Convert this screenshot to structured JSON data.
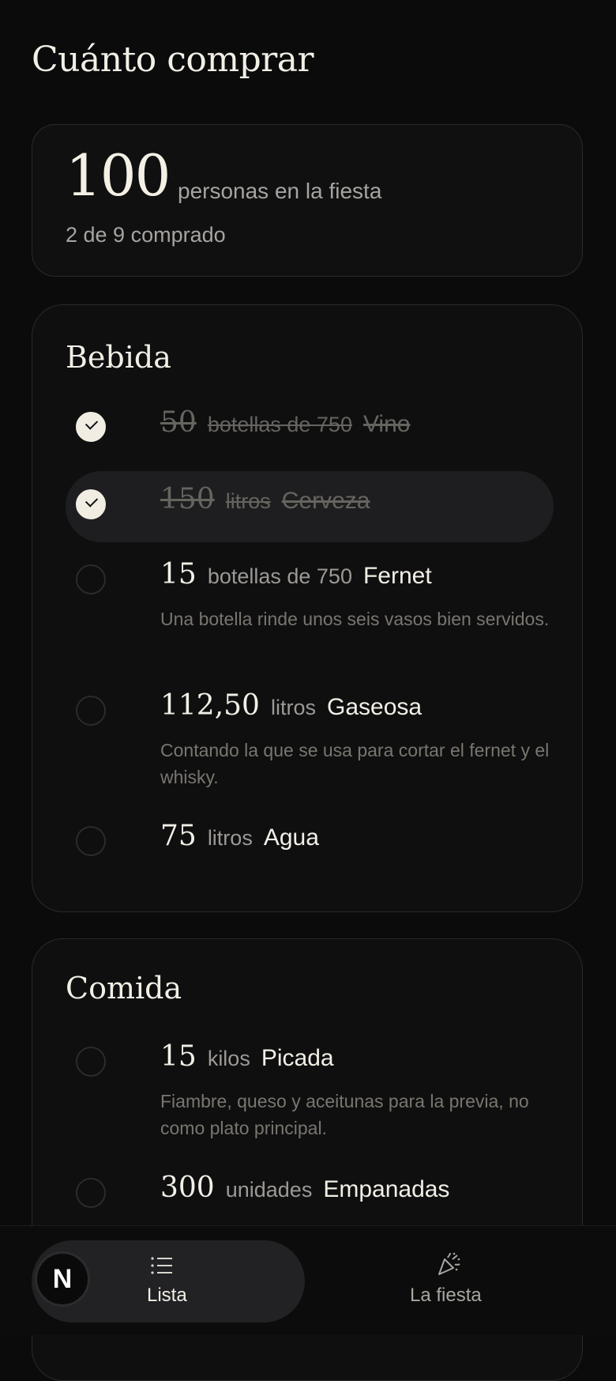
{
  "page": {
    "title": "Cuánto comprar"
  },
  "summary": {
    "people": "100",
    "people_label": "personas en la fiesta",
    "progress": "2 de 9 comprado"
  },
  "sections": [
    {
      "title": "Bebida",
      "items": [
        {
          "qty": "50",
          "unit": "botellas de 750",
          "name": "Vino",
          "checked": true,
          "note": ""
        },
        {
          "qty": "150",
          "unit": "litros",
          "name": "Cerveza",
          "checked": true,
          "note": ""
        },
        {
          "qty": "15",
          "unit": "botellas de 750",
          "name": "Fernet",
          "checked": false,
          "note": "Una botella rinde unos seis vasos bien servidos."
        },
        {
          "qty": "112,50",
          "unit": "litros",
          "name": "Gaseosa",
          "checked": false,
          "note": "Contando la que se usa para cortar el fernet y el whisky."
        },
        {
          "qty": "75",
          "unit": "litros",
          "name": "Agua",
          "checked": false,
          "note": ""
        }
      ]
    },
    {
      "title": "Comida",
      "items": [
        {
          "qty": "15",
          "unit": "kilos",
          "name": "Picada",
          "checked": false,
          "note": "Fiambre, queso y aceitunas para la previa, no como plato principal."
        },
        {
          "qty": "300",
          "unit": "unidades",
          "name": "Empanadas",
          "checked": false,
          "note": ""
        }
      ]
    }
  ],
  "nav": {
    "avatar_letter": "N",
    "tabs": [
      {
        "label": "Lista",
        "icon": "list-icon",
        "active": true
      },
      {
        "label": "La fiesta",
        "icon": "party-popper-icon",
        "active": false
      }
    ]
  }
}
